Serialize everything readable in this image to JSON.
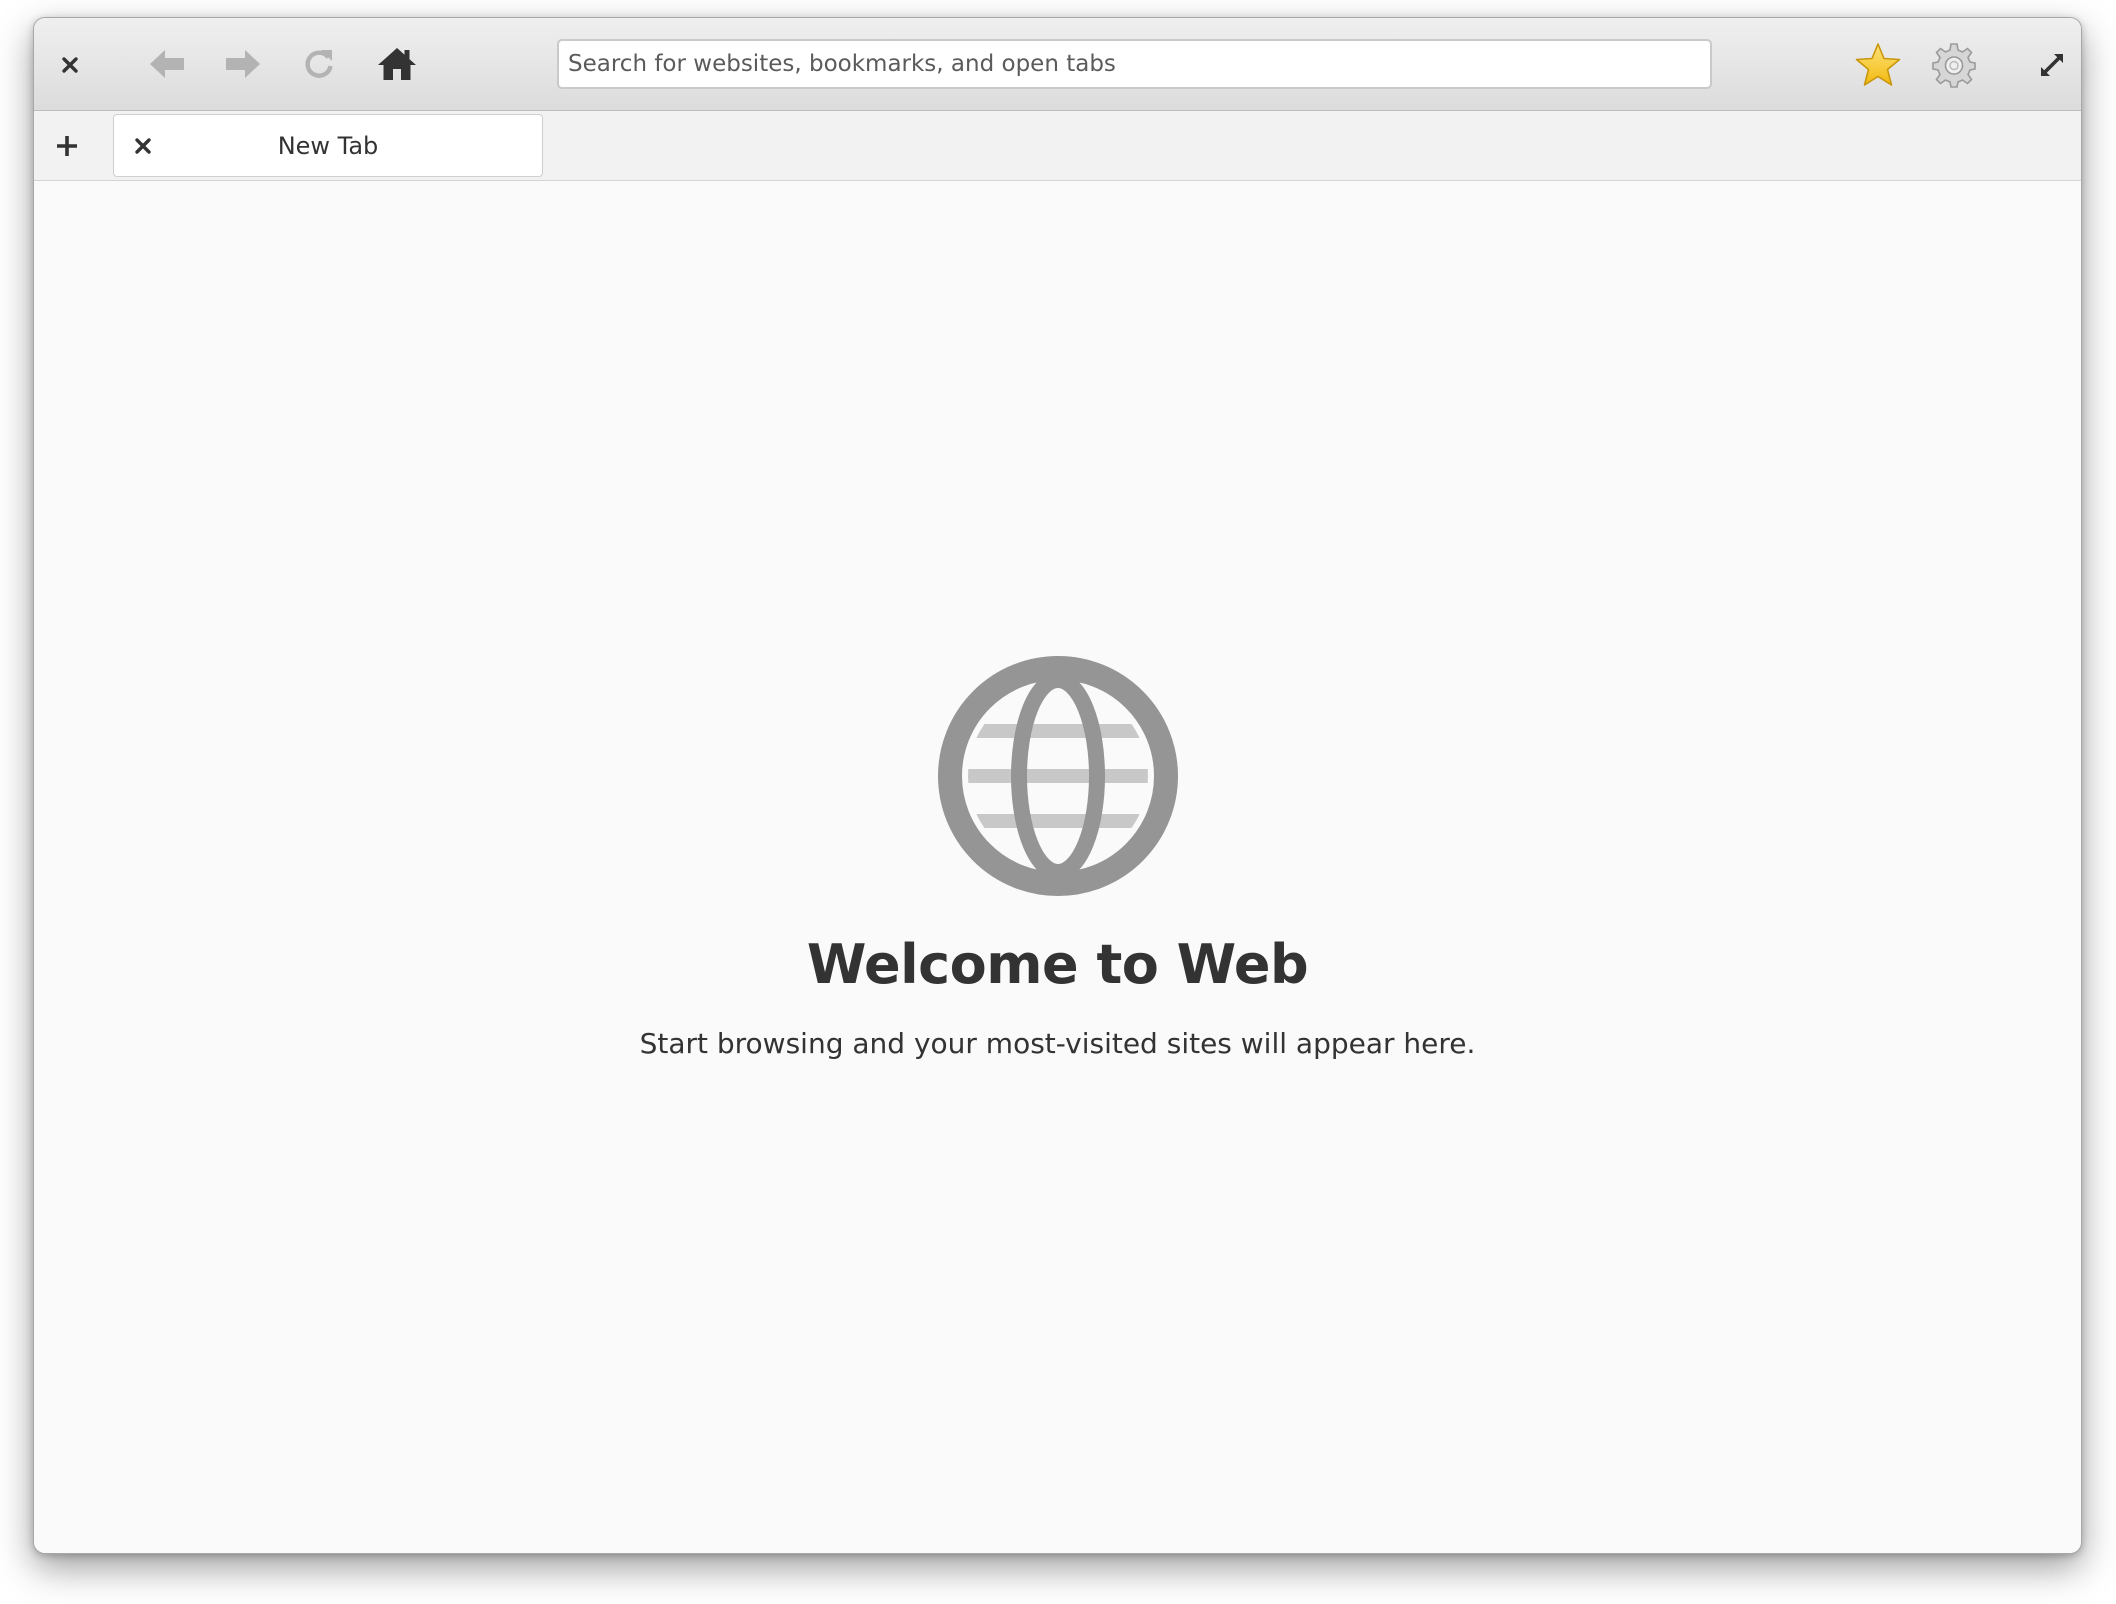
{
  "toolbar": {
    "close_icon": "close-icon",
    "back_icon": "arrow-left-icon",
    "forward_icon": "arrow-right-icon",
    "reload_icon": "reload-icon",
    "home_icon": "home-icon",
    "bookmark_icon": "star-icon",
    "settings_icon": "gear-icon",
    "fullscreen_icon": "fullscreen-icon",
    "search": {
      "value": "",
      "placeholder": "Search for websites, bookmarks, and open tabs"
    }
  },
  "tabs": {
    "new_tab_icon": "plus-icon",
    "items": [
      {
        "label": "New Tab",
        "close_icon": "close-icon"
      }
    ]
  },
  "welcome": {
    "icon": "globe-icon",
    "title": "Welcome to Web",
    "subtitle": "Start browsing and your most-visited sites will appear here."
  },
  "colors": {
    "icon_dark": "#333333",
    "icon_disabled": "#b3b3b3",
    "star": "#f5c211",
    "globe": "#959595"
  }
}
